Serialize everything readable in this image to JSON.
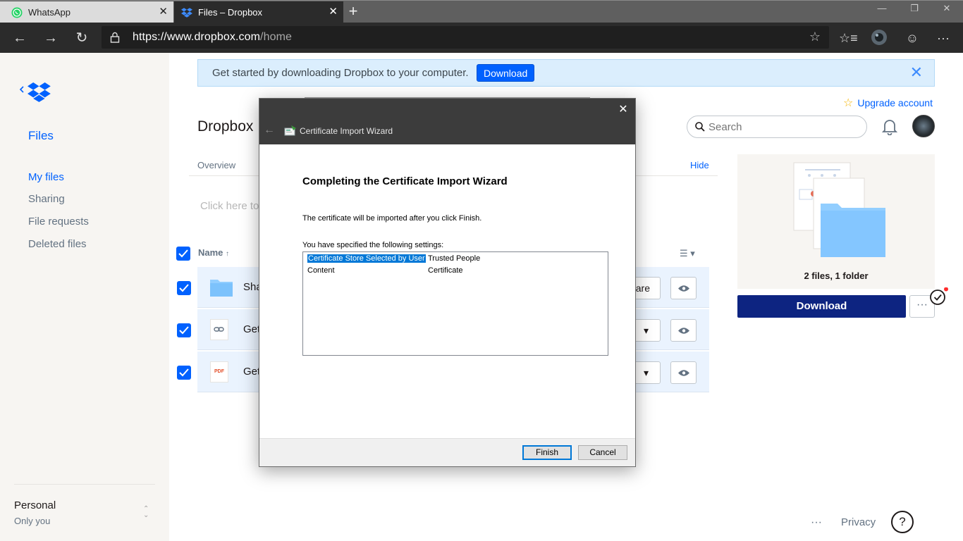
{
  "browser": {
    "tabs": [
      {
        "label": "WhatsApp",
        "icon": "whatsapp-icon",
        "active": false
      },
      {
        "label": "Files – Dropbox",
        "icon": "dropbox-icon",
        "active": true
      }
    ],
    "url_host": "https://www.dropbox.com",
    "url_path": "/home"
  },
  "sidebar": {
    "heading": "Files",
    "items": [
      {
        "label": "My files",
        "active": true
      },
      {
        "label": "Sharing"
      },
      {
        "label": "File requests"
      },
      {
        "label": "Deleted files"
      }
    ],
    "account_name": "Personal",
    "account_sub": "Only you"
  },
  "banner": {
    "text": "Get started by downloading Dropbox to your computer.",
    "button": "Download"
  },
  "header": {
    "title": "Dropbox",
    "upgrade": "Upgrade account",
    "search_placeholder": "Search"
  },
  "overview": {
    "tab": "Overview",
    "hide": "Hide",
    "description_placeholder": "Click here to"
  },
  "file_list": {
    "name_header": "Name",
    "rows": [
      {
        "name": "Sha",
        "icon": "folder-icon",
        "action": "are"
      },
      {
        "name": "Get",
        "icon": "link-icon",
        "action": "▾"
      },
      {
        "name": "Get",
        "icon": "pdf-icon",
        "icon_text": "PDF",
        "action": "▾"
      }
    ]
  },
  "preview": {
    "summary": "2 files, 1 folder",
    "download": "Download",
    "more": "···"
  },
  "footer": {
    "more": "···",
    "privacy": "Privacy",
    "help": "?"
  },
  "dialog": {
    "caption": "Certificate Import Wizard",
    "heading": "Completing the Certificate Import Wizard",
    "text1": "The certificate will be imported after you click Finish.",
    "text2": "You have specified the following settings:",
    "settings": [
      {
        "key": "Certificate Store Selected by User",
        "value": "Trusted People"
      },
      {
        "key": "Content",
        "value": "Certificate"
      }
    ],
    "finish": "Finish",
    "cancel": "Cancel"
  },
  "colors": {
    "dropbox_blue": "#0061fe",
    "download_navy": "#0d2481",
    "banner_bg": "#dbeefd",
    "row_selected": "#eaf3fe",
    "dialog_titlebar": "#3c3c3c"
  }
}
